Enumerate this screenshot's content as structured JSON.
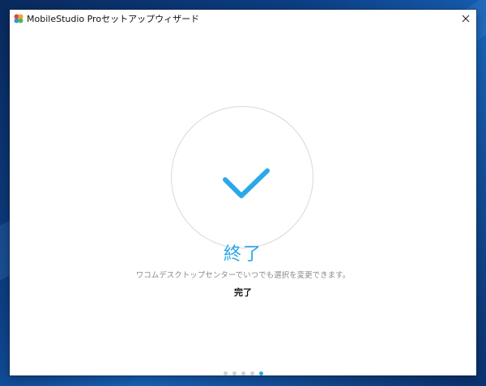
{
  "window": {
    "title": "MobileStudio Proセットアップウィザード",
    "close_label": "✕"
  },
  "main": {
    "heading": "終了",
    "hint": "ワコムデスクトップセンターでいつでも選択を変更できます。",
    "finish_label": "完了"
  },
  "pagination": {
    "total": 5,
    "current": 5
  },
  "colors": {
    "accent": "#2aa8e8",
    "circle_border": "#d8d8d8",
    "dot_inactive": "#cfcfcf"
  },
  "icons": {
    "app": "wacom-app-icon",
    "close": "close-icon",
    "check": "checkmark-icon"
  }
}
